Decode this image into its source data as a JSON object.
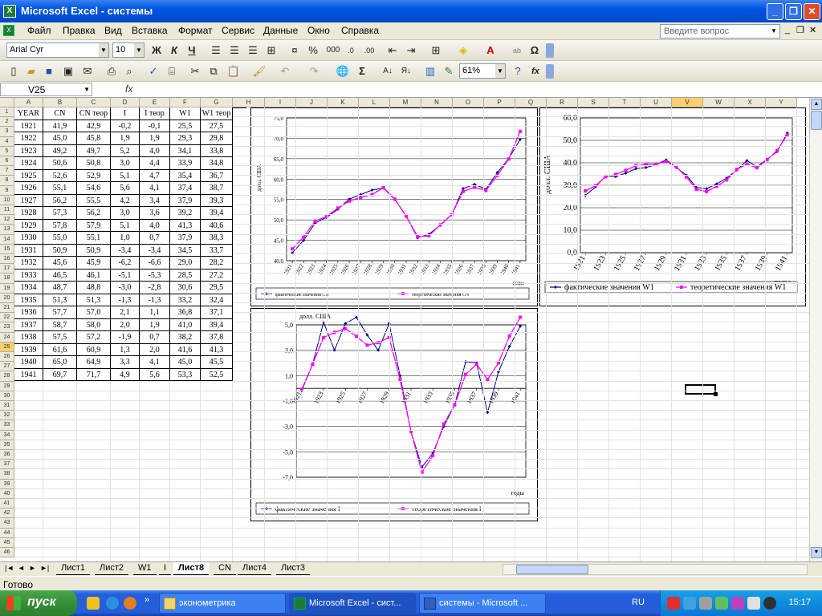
{
  "window": {
    "title": "Microsoft Excel - системы",
    "app_icon": "X"
  },
  "menu": {
    "items": [
      "Файл",
      "Правка",
      "Вид",
      "Вставка",
      "Формат",
      "Сервис",
      "Данные",
      "Окно",
      "Справка"
    ],
    "ask_placeholder": "Введите вопрос"
  },
  "toolbar": {
    "font_name": "Arial Cyr",
    "font_size": "10",
    "bold": "Ж",
    "italic": "К",
    "underline": "Ч",
    "percent": "%",
    "thousands": "000",
    "sigma": "Σ",
    "zoom": "61%",
    "omega": "Ω",
    "fx": "fx",
    "font_color_label": "А"
  },
  "formula_bar": {
    "name_box": "V25",
    "fx": "fx"
  },
  "grid": {
    "columns": [
      "A",
      "B",
      "C",
      "D",
      "E",
      "F",
      "G",
      "H",
      "I",
      "J",
      "K",
      "L",
      "M",
      "N",
      "O",
      "P",
      "Q",
      "R",
      "S",
      "T",
      "U",
      "V",
      "W",
      "X",
      "Y"
    ],
    "rows": [
      "1",
      "2",
      "3",
      "4",
      "5",
      "6",
      "7",
      "8",
      "9",
      "10",
      "11",
      "12",
      "13",
      "14",
      "15",
      "16",
      "17",
      "18",
      "19",
      "20",
      "21",
      "22",
      "23",
      "24",
      "25",
      "26",
      "27",
      "28",
      "29",
      "30",
      "31",
      "32",
      "33",
      "34",
      "35",
      "36",
      "37",
      "38",
      "39",
      "40",
      "41",
      "42",
      "43",
      "44",
      "45",
      "46"
    ],
    "selected_column": "V",
    "selected_row": "25"
  },
  "table": {
    "headers": [
      "YEAR",
      "CN",
      "CN теор",
      "I",
      "I теор",
      "W1",
      "W1 теор"
    ],
    "rows": [
      [
        "1921",
        "41,9",
        "42,9",
        "-0,2",
        "-0,1",
        "25,5",
        "27,5"
      ],
      [
        "1922",
        "45,0",
        "45,8",
        "1,9",
        "1,9",
        "29,3",
        "29,8"
      ],
      [
        "1923",
        "49,2",
        "49,7",
        "5,2",
        "4,0",
        "34,1",
        "33,8"
      ],
      [
        "1924",
        "50,6",
        "50,8",
        "3,0",
        "4,4",
        "33,9",
        "34,8"
      ],
      [
        "1925",
        "52,6",
        "52,9",
        "5,1",
        "4,7",
        "35,4",
        "36,7"
      ],
      [
        "1926",
        "55,1",
        "54,6",
        "5,6",
        "4,1",
        "37,4",
        "38,7"
      ],
      [
        "1927",
        "56,2",
        "55,5",
        "4,2",
        "3,4",
        "37,9",
        "39,3"
      ],
      [
        "1928",
        "57,3",
        "56,2",
        "3,0",
        "3,6",
        "39,2",
        "39,4"
      ],
      [
        "1929",
        "57,8",
        "57,9",
        "5,1",
        "4,0",
        "41,3",
        "40,6"
      ],
      [
        "1930",
        "55,0",
        "55,1",
        "1,0",
        "0,7",
        "37,9",
        "38,3"
      ],
      [
        "1931",
        "50,9",
        "50,9",
        "-3,4",
        "-3,4",
        "34,5",
        "33,7"
      ],
      [
        "1932",
        "45,6",
        "45,9",
        "-6,2",
        "-6,6",
        "29,0",
        "28,2"
      ],
      [
        "1933",
        "46,5",
        "46,1",
        "-5,1",
        "-5,3",
        "28,5",
        "27,2"
      ],
      [
        "1934",
        "48,7",
        "48,8",
        "-3,0",
        "-2,8",
        "30,6",
        "29,5"
      ],
      [
        "1935",
        "51,3",
        "51,3",
        "-1,3",
        "-1,3",
        "33,2",
        "32,4"
      ],
      [
        "1936",
        "57,7",
        "57,0",
        "2,1",
        "1,1",
        "36,8",
        "37,1"
      ],
      [
        "1937",
        "58,7",
        "58,0",
        "2,0",
        "1,9",
        "41,0",
        "39,4"
      ],
      [
        "1938",
        "57,5",
        "57,2",
        "-1,9",
        "0,7",
        "38,2",
        "37,8"
      ],
      [
        "1939",
        "61,6",
        "60,9",
        "1,3",
        "2,0",
        "41,6",
        "41,3"
      ],
      [
        "1940",
        "65,0",
        "64,9",
        "3,3",
        "4,1",
        "45,0",
        "45,5"
      ],
      [
        "1941",
        "69,7",
        "71,7",
        "4,9",
        "5,6",
        "53,3",
        "52,5"
      ]
    ]
  },
  "chart_data": [
    {
      "type": "line",
      "title": "",
      "xlabel": "годы",
      "ylabel": "долл. США",
      "ylim": [
        40.0,
        75.0
      ],
      "yticks": [
        "40,0",
        "45,0",
        "50,0",
        "55,0",
        "60,0",
        "65,0",
        "70,0",
        "75,0"
      ],
      "categories": [
        "1921",
        "1922",
        "1923",
        "1924",
        "1925",
        "1926",
        "1927",
        "1928",
        "1929",
        "1930",
        "1931",
        "1932",
        "1933",
        "1934",
        "1935",
        "1936",
        "1937",
        "1938",
        "1939",
        "1940",
        "1941"
      ],
      "series": [
        {
          "name": "фактические значения CN",
          "color": "#000080",
          "values": [
            41.9,
            45.0,
            49.2,
            50.6,
            52.6,
            55.1,
            56.2,
            57.3,
            57.8,
            55.0,
            50.9,
            45.6,
            46.5,
            48.7,
            51.3,
            57.7,
            58.7,
            57.5,
            61.6,
            65.0,
            69.7
          ]
        },
        {
          "name": "теоретические значения CN",
          "color": "#ff00ff",
          "values": [
            42.9,
            45.8,
            49.7,
            50.8,
            52.9,
            54.6,
            55.5,
            56.2,
            57.9,
            55.1,
            50.9,
            45.9,
            46.1,
            48.8,
            51.3,
            57.0,
            58.0,
            57.2,
            60.9,
            64.9,
            71.7
          ]
        }
      ],
      "legend": "bottom",
      "grid": true
    },
    {
      "type": "line",
      "title": "",
      "xlabel": "годы",
      "ylabel": "долл. США",
      "ylim": [
        0.0,
        60.0
      ],
      "yticks": [
        "0,0",
        "10,0",
        "20,0",
        "30,0",
        "40,0",
        "50,0",
        "60,0"
      ],
      "categories": [
        "1921",
        "1922",
        "1923",
        "1924",
        "1925",
        "1926",
        "1927",
        "1928",
        "1929",
        "1930",
        "1931",
        "1932",
        "1933",
        "1934",
        "1935",
        "1936",
        "1937",
        "1938",
        "1939",
        "1940",
        "1941"
      ],
      "xticks": [
        "1921",
        "1923",
        "1925",
        "1927",
        "1929",
        "1931",
        "1933",
        "1935",
        "1937",
        "1939",
        "1941"
      ],
      "series": [
        {
          "name": "фактические значения W1",
          "color": "#000080",
          "values": [
            25.5,
            29.3,
            34.1,
            33.9,
            35.4,
            37.4,
            37.9,
            39.2,
            41.3,
            37.9,
            34.5,
            29.0,
            28.5,
            30.6,
            33.2,
            36.8,
            41.0,
            38.2,
            41.6,
            45.0,
            53.3
          ]
        },
        {
          "name": "теоретические значения W1",
          "color": "#ff00ff",
          "values": [
            27.5,
            29.8,
            33.8,
            34.8,
            36.7,
            38.7,
            39.3,
            39.4,
            40.6,
            38.3,
            33.7,
            28.2,
            27.2,
            29.5,
            32.4,
            37.1,
            39.4,
            37.8,
            41.3,
            45.5,
            52.5
          ]
        }
      ],
      "legend": "bottom",
      "grid": true
    },
    {
      "type": "line",
      "title": "",
      "xlabel": "годы",
      "ylabel": "долл. США",
      "ylim": [
        -7.0,
        5.0
      ],
      "yticks": [
        "-7,0",
        "-5,0",
        "-3,0",
        "-1,0",
        "1,0",
        "3,0",
        "5,0"
      ],
      "categories": [
        "1921",
        "1922",
        "1923",
        "1924",
        "1925",
        "1926",
        "1927",
        "1928",
        "1929",
        "1930",
        "1931",
        "1932",
        "1933",
        "1934",
        "1935",
        "1936",
        "1937",
        "1938",
        "1939",
        "1940",
        "1941"
      ],
      "xticks": [
        "1921",
        "1923",
        "1925",
        "1927",
        "1929",
        "1931",
        "1933",
        "1935",
        "1937",
        "1939",
        "1941"
      ],
      "series": [
        {
          "name": "фактические значения I",
          "color": "#000080",
          "values": [
            -0.2,
            1.9,
            5.2,
            3.0,
            5.1,
            5.6,
            4.2,
            3.0,
            5.1,
            1.0,
            -3.4,
            -6.2,
            -5.1,
            -3.0,
            -1.3,
            2.1,
            2.0,
            -1.9,
            1.3,
            3.3,
            4.9
          ]
        },
        {
          "name": "теоретические значения I",
          "color": "#ff00ff",
          "values": [
            -0.1,
            1.9,
            4.0,
            4.4,
            4.7,
            4.1,
            3.4,
            3.6,
            4.0,
            0.7,
            -3.4,
            -6.6,
            -5.3,
            -2.8,
            -1.3,
            1.1,
            1.9,
            0.7,
            2.0,
            4.1,
            5.6
          ]
        }
      ],
      "legend": "bottom",
      "grid": true
    }
  ],
  "sheets": {
    "tabs": [
      "Лист1",
      "Лист2",
      "W1",
      "I",
      "Лист8",
      "CN",
      "Лист4",
      "Лист3"
    ],
    "active": "Лист8",
    "nav": [
      "|◄",
      "◄",
      "►",
      "►|"
    ]
  },
  "status": {
    "text": "Готово"
  },
  "taskbar": {
    "start": "пуск",
    "tasks": [
      "эконометрика",
      "Microsoft Excel - сист...",
      "системы - Microsoft ..."
    ],
    "lang": "RU",
    "clock": "15:17",
    "more": "»"
  }
}
